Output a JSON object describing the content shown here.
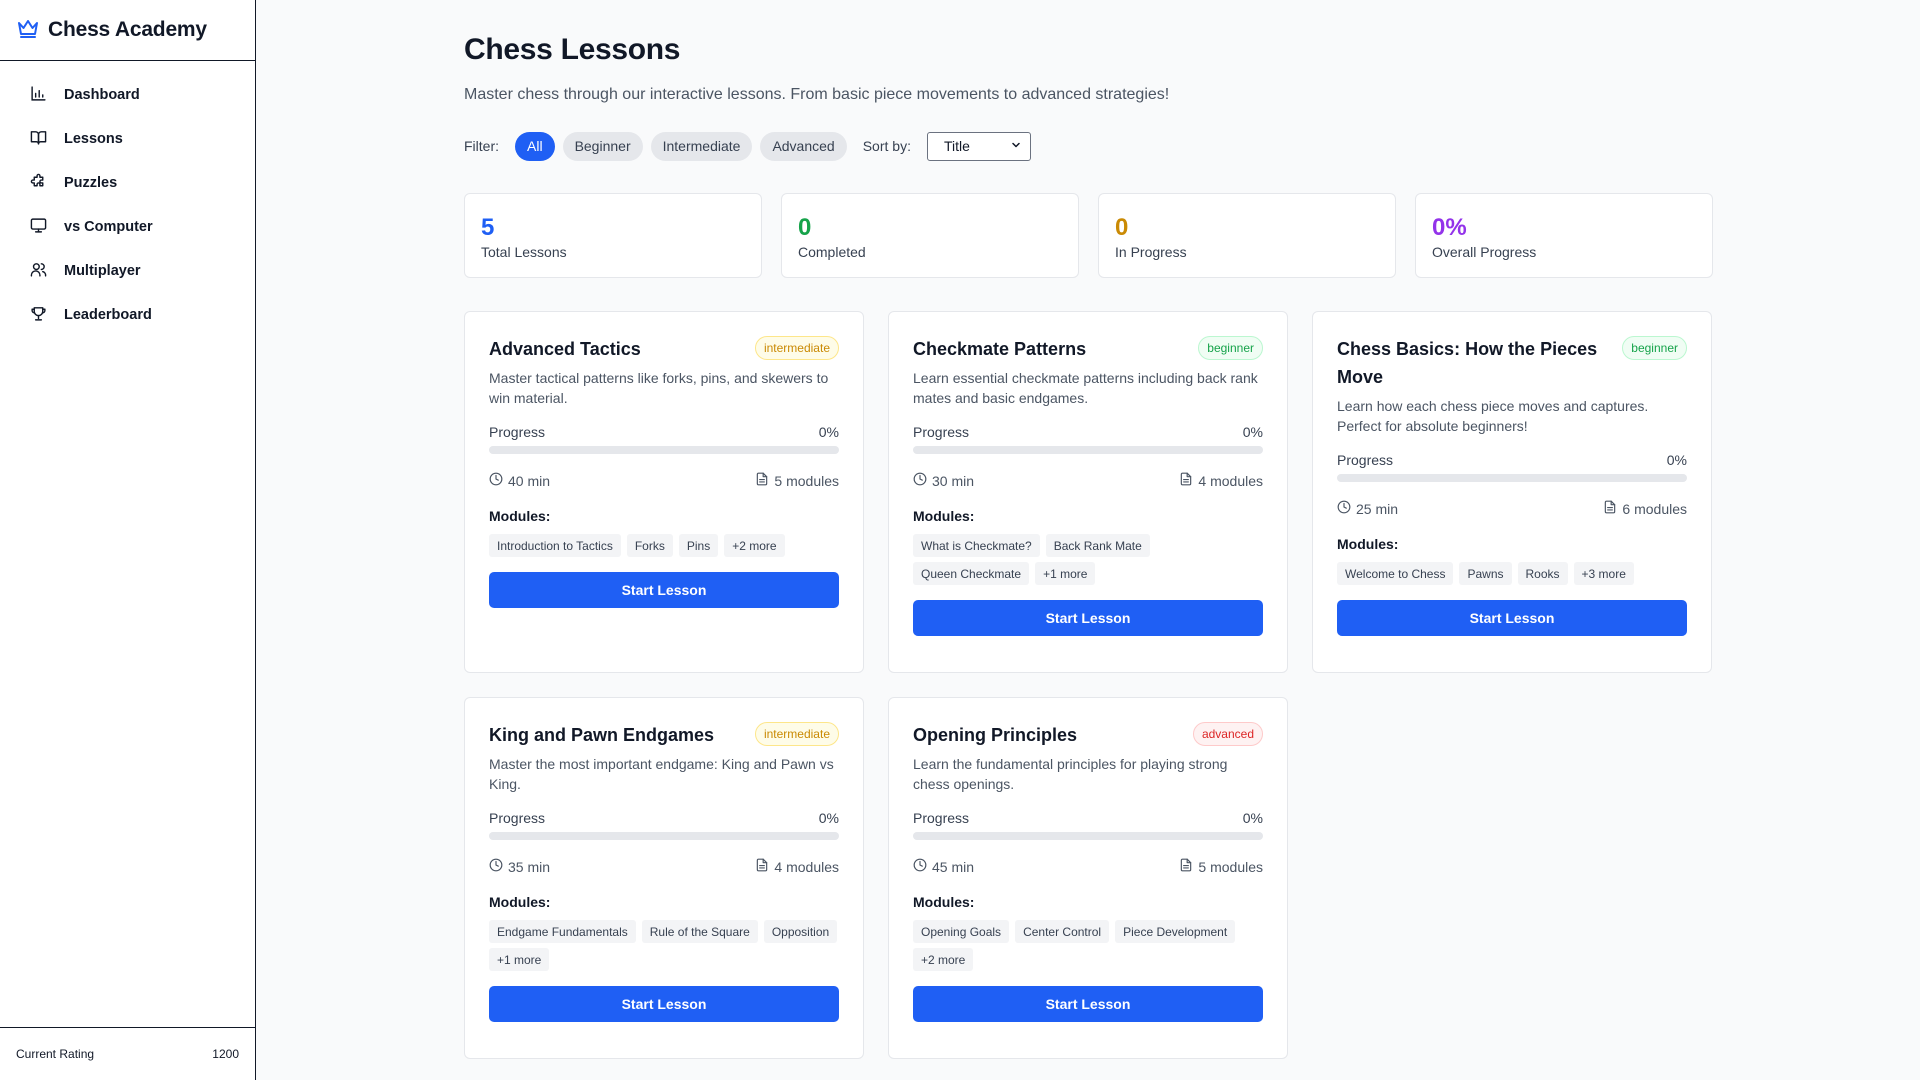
{
  "app": {
    "title": "Chess Academy",
    "icon": "crown-icon"
  },
  "sidebar": {
    "items": [
      {
        "label": "Dashboard",
        "icon": "bar-chart-icon"
      },
      {
        "label": "Lessons",
        "icon": "book-open-icon"
      },
      {
        "label": "Puzzles",
        "icon": "puzzle-icon"
      },
      {
        "label": "vs Computer",
        "icon": "monitor-icon"
      },
      {
        "label": "Multiplayer",
        "icon": "users-icon"
      },
      {
        "label": "Leaderboard",
        "icon": "trophy-icon"
      }
    ],
    "footer": {
      "label": "Current Rating",
      "value": "1200"
    }
  },
  "page": {
    "title": "Chess Lessons",
    "subtitle": "Master chess through our interactive lessons. From basic piece movements to advanced strategies!"
  },
  "filters": {
    "label": "Filter:",
    "options": [
      "All",
      "Beginner",
      "Intermediate",
      "Advanced"
    ],
    "active": "All",
    "sort_label": "Sort by:",
    "sort_value": "Title"
  },
  "stats": [
    {
      "value": "5",
      "label": "Total Lessons",
      "color": "#1f5ff4"
    },
    {
      "value": "0",
      "label": "Completed",
      "color": "#16a34a"
    },
    {
      "value": "0",
      "label": "In Progress",
      "color": "#ca8a04"
    },
    {
      "value": "0%",
      "label": "Overall Progress",
      "color": "#9333ea"
    }
  ],
  "lessons": [
    {
      "title": "Advanced Tactics",
      "level": "intermediate",
      "description": "Master tactical patterns like forks, pins, and skewers to win material.",
      "progress_label": "Progress",
      "progress": "0%",
      "progress_value": 0,
      "duration": "40 min",
      "modules_count": "5 modules",
      "modules_label": "Modules:",
      "modules": [
        "Introduction to Tactics",
        "Forks",
        "Pins",
        "+2 more"
      ],
      "button": "Start Lesson"
    },
    {
      "title": "Checkmate Patterns",
      "level": "beginner",
      "description": "Learn essential checkmate patterns including back rank mates and basic endgames.",
      "progress_label": "Progress",
      "progress": "0%",
      "progress_value": 0,
      "duration": "30 min",
      "modules_count": "4 modules",
      "modules_label": "Modules:",
      "modules": [
        "What is Checkmate?",
        "Back Rank Mate",
        "Queen Checkmate",
        "+1 more"
      ],
      "button": "Start Lesson"
    },
    {
      "title": "Chess Basics: How the Pieces Move",
      "level": "beginner",
      "description": "Learn how each chess piece moves and captures. Perfect for absolute beginners!",
      "progress_label": "Progress",
      "progress": "0%",
      "progress_value": 0,
      "duration": "25 min",
      "modules_count": "6 modules",
      "modules_label": "Modules:",
      "modules": [
        "Welcome to Chess",
        "Pawns",
        "Rooks",
        "+3 more"
      ],
      "button": "Start Lesson"
    },
    {
      "title": "King and Pawn Endgames",
      "level": "intermediate",
      "description": "Master the most important endgame: King and Pawn vs King.",
      "progress_label": "Progress",
      "progress": "0%",
      "progress_value": 0,
      "duration": "35 min",
      "modules_count": "4 modules",
      "modules_label": "Modules:",
      "modules": [
        "Endgame Fundamentals",
        "Rule of the Square",
        "Opposition",
        "+1 more"
      ],
      "button": "Start Lesson"
    },
    {
      "title": "Opening Principles",
      "level": "advanced",
      "description": "Learn the fundamental principles for playing strong chess openings.",
      "progress_label": "Progress",
      "progress": "0%",
      "progress_value": 0,
      "duration": "45 min",
      "modules_count": "5 modules",
      "modules_label": "Modules:",
      "modules": [
        "Opening Goals",
        "Center Control",
        "Piece Development",
        "+2 more"
      ],
      "button": "Start Lesson"
    }
  ]
}
